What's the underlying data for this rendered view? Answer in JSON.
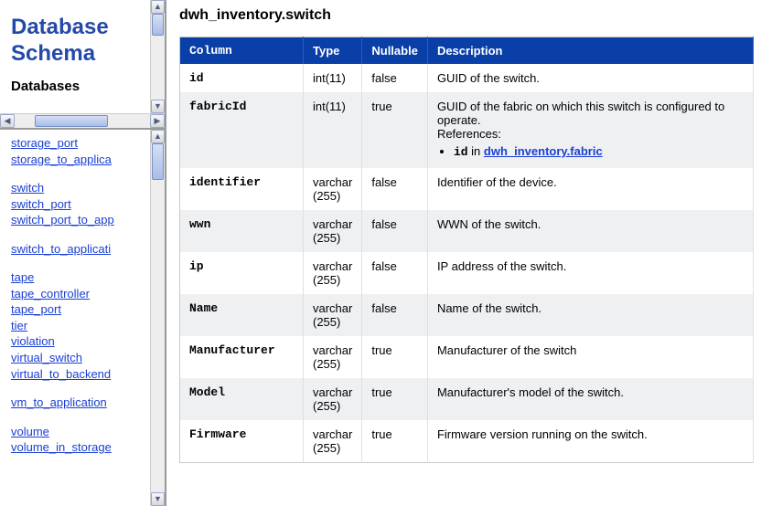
{
  "sidebar": {
    "title": "Database Schema",
    "section": "Databases",
    "groups": [
      [
        "storage_port",
        "storage_to_applica"
      ],
      [
        "switch",
        "switch_port",
        "switch_port_to_app"
      ],
      [
        "switch_to_applicati"
      ],
      [
        "tape",
        "tape_controller",
        "tape_port",
        "tier",
        "violation",
        "virtual_switch",
        "virtual_to_backend"
      ],
      [
        "vm_to_application"
      ],
      [
        "volume",
        "volume_in_storage"
      ]
    ]
  },
  "page": {
    "title": "dwh_inventory.switch"
  },
  "headers": {
    "column": "Column",
    "type": "Type",
    "nullable": "Nullable",
    "description": "Description"
  },
  "rows": [
    {
      "column": "id",
      "type": "int(11)",
      "nullable": "false",
      "desc": "GUID of the switch."
    },
    {
      "column": "fabricId",
      "type": "int(11)",
      "nullable": "true",
      "desc": "GUID of the fabric on which this switch is configured to operate.",
      "refs_label": "References:",
      "ref_code": "id",
      "ref_in": " in ",
      "ref_link": "dwh_inventory.fabric"
    },
    {
      "column": "identifier",
      "type": "varchar (255)",
      "nullable": "false",
      "desc": "Identifier of the device."
    },
    {
      "column": "wwn",
      "type": "varchar (255)",
      "nullable": "false",
      "desc": "WWN of the switch."
    },
    {
      "column": "ip",
      "type": "varchar (255)",
      "nullable": "false",
      "desc": "IP address of the switch."
    },
    {
      "column": "Name",
      "type": "varchar (255)",
      "nullable": "false",
      "desc": "Name of the switch."
    },
    {
      "column": "Manufacturer",
      "type": "varchar (255)",
      "nullable": "true",
      "desc": "Manufacturer of the switch"
    },
    {
      "column": "Model",
      "type": "varchar (255)",
      "nullable": "true",
      "desc": "Manufacturer's model of the switch."
    },
    {
      "column": "Firmware",
      "type": "varchar (255)",
      "nullable": "true",
      "desc": "Firmware version running on the switch."
    }
  ]
}
